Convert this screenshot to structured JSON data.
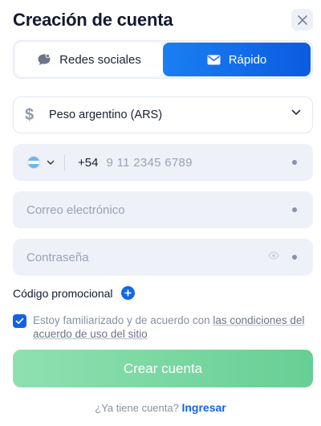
{
  "header": {
    "title": "Creación de cuenta",
    "close_icon": "close-icon"
  },
  "tabs": [
    {
      "label": "Redes sociales",
      "icon": "chat-bubble-icon",
      "selected": false
    },
    {
      "label": "Rápido",
      "icon": "envelope-icon",
      "selected": true
    }
  ],
  "currency": {
    "icon": "dollar-icon",
    "value": "Peso argentino (ARS)"
  },
  "phone": {
    "country_flag": "argentina-flag-icon",
    "dial_code": "+54",
    "placeholder": "9 11 2345 6789"
  },
  "email": {
    "placeholder": "Correo electrónico"
  },
  "password": {
    "placeholder": "Contraseña"
  },
  "promo": {
    "label": "Código promocional"
  },
  "agreement": {
    "checked": true,
    "text": "Estoy familiarizado y de acuerdo con ",
    "link": "las condiciones del acuerdo de uso del sitio"
  },
  "submit": {
    "label": "Crear cuenta"
  },
  "footer": {
    "question": "¿Ya tiene cuenta?",
    "login_link": "Ingresar"
  },
  "colors": {
    "accent": "#1463e6",
    "tab_active_gradient_start": "#1a7ff2",
    "tab_active_gradient_end": "#0d5be0",
    "submit_gradient_start": "#8fe0b0",
    "submit_gradient_end": "#67cf94",
    "field_bg": "#eef1f8",
    "text_primary": "#141a2e",
    "text_muted": "#9aa2b4"
  }
}
